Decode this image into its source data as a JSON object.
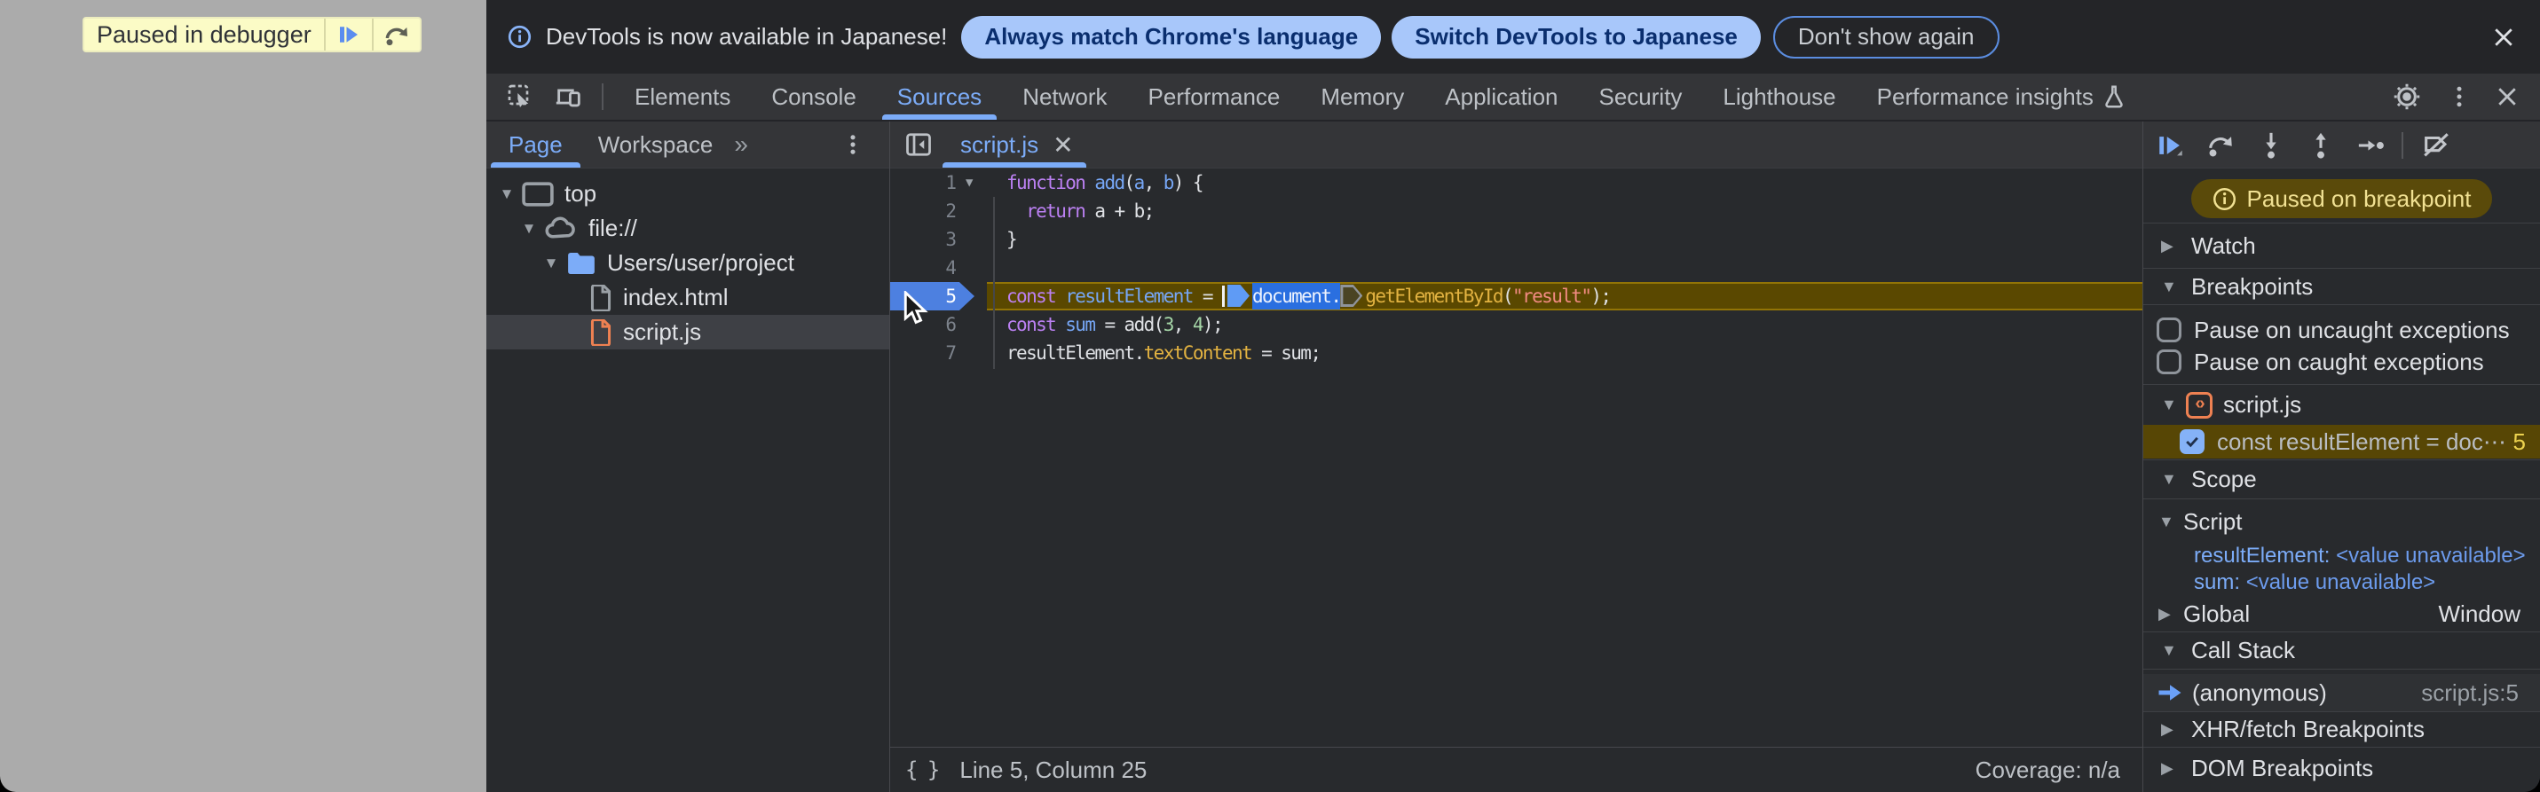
{
  "page": {
    "paused_label": "Paused in debugger"
  },
  "infobar": {
    "message": "DevTools is now available in Japanese!",
    "btn_match": "Always match Chrome's language",
    "btn_switch": "Switch DevTools to Japanese",
    "btn_dismiss": "Don't show again"
  },
  "tabs": {
    "items": [
      "Elements",
      "Console",
      "Sources",
      "Network",
      "Performance",
      "Memory",
      "Application",
      "Security",
      "Lighthouse",
      "Performance insights"
    ],
    "selected": "Sources"
  },
  "nav": {
    "page": "Page",
    "workspace": "Workspace",
    "more": "»"
  },
  "tree": {
    "rows": [
      {
        "label": "top"
      },
      {
        "label": "file://"
      },
      {
        "label": "Users/user/project"
      },
      {
        "label": "index.html"
      },
      {
        "label": "script.js"
      }
    ]
  },
  "editor": {
    "tab": "script.js",
    "close": "×",
    "braces": "{ }",
    "status_left": "Line 5, Column 25",
    "status_right": "Coverage: n/a"
  },
  "code_lines": [
    {
      "num": "1",
      "fold": true,
      "tokens": [
        [
          "kw",
          "function"
        ],
        [
          "pl",
          " "
        ],
        [
          "def",
          "add"
        ],
        [
          "pl",
          "("
        ],
        [
          "def",
          "a"
        ],
        [
          "pl",
          ", "
        ],
        [
          "def",
          "b"
        ],
        [
          "pl",
          ") {"
        ]
      ]
    },
    {
      "num": "2",
      "tokens": [
        [
          "pl",
          "  "
        ],
        [
          "kw",
          "return"
        ],
        [
          "pl",
          " a + b;"
        ]
      ]
    },
    {
      "num": "3",
      "tokens": [
        [
          "pl",
          "}"
        ]
      ]
    },
    {
      "num": "4",
      "tokens": []
    },
    {
      "num": "5",
      "paused": true,
      "tokens": [
        [
          "kw",
          "const"
        ],
        [
          "pl",
          " "
        ],
        [
          "def",
          "resultElement"
        ],
        [
          "pl",
          " = "
        ],
        [
          "caret",
          ""
        ],
        [
          "mkb",
          ""
        ],
        [
          "seltok",
          "document."
        ],
        [
          "mkd",
          ""
        ],
        [
          "prop",
          "getElementById"
        ],
        [
          "pl",
          "("
        ],
        [
          "str",
          "\"result\""
        ],
        [
          "pl",
          ");"
        ]
      ]
    },
    {
      "num": "6",
      "tokens": [
        [
          "kw",
          "const"
        ],
        [
          "pl",
          " "
        ],
        [
          "def",
          "sum"
        ],
        [
          "pl",
          " = add("
        ],
        [
          "nm",
          "3"
        ],
        [
          "pl",
          ", "
        ],
        [
          "nm",
          "4"
        ],
        [
          "pl",
          ");"
        ]
      ]
    },
    {
      "num": "7",
      "tokens": [
        [
          "pl",
          "resultElement."
        ],
        [
          "prop",
          "textContent"
        ],
        [
          "pl",
          " = sum;"
        ]
      ]
    }
  ],
  "debugger": {
    "paused_badge": "Paused on breakpoint",
    "watch": "Watch",
    "breakpoints": {
      "title": "Breakpoints",
      "uncaught": "Pause on uncaught exceptions",
      "caught": "Pause on caught exceptions",
      "group": "script.js",
      "entry": "const resultElement = doc⋯",
      "entry_line": "5"
    },
    "scope": {
      "title": "Scope",
      "script": "Script",
      "var1_name": "resultElement",
      "var1_value": "<value unavailable>",
      "var2_name": "sum",
      "var2_value": "<value unavailable>",
      "global": "Global",
      "global_value": "Window"
    },
    "callstack": {
      "title": "Call Stack",
      "frame": "(anonymous)",
      "location": "script.js:5"
    },
    "xhr": "XHR/fetch Breakpoints",
    "dom": "DOM Breakpoints"
  }
}
